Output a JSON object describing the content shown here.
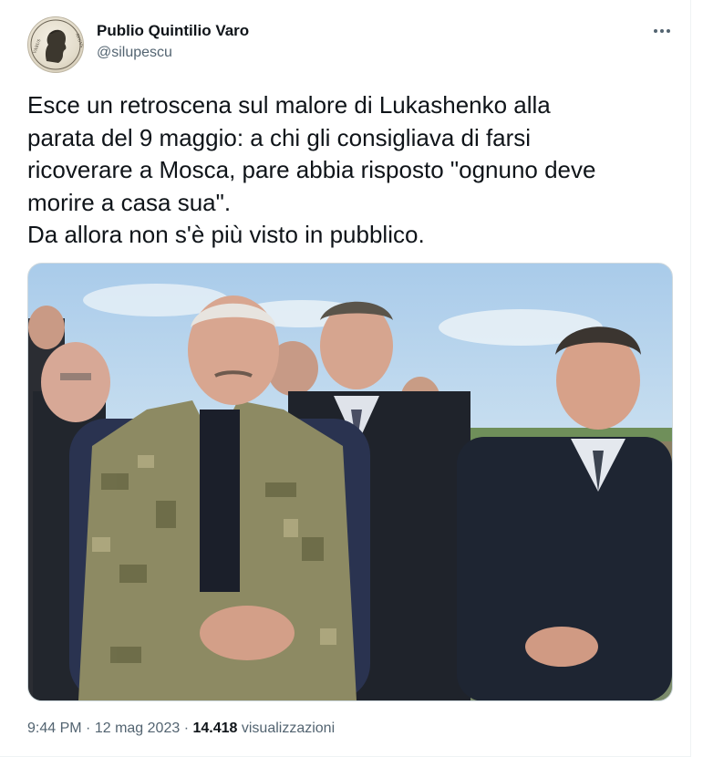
{
  "author": {
    "display_name": "Publio Quintilio Varo",
    "handle": "@silupescu",
    "avatar_icon": "roman-coin-portrait-icon"
  },
  "tweet": {
    "text": "Esce un retroscena sul malore di Lukashenko alla\nparata del 9 maggio: a chi gli consigliava di farsi\nricoverare a Mosca, pare abbia risposto \"ognuno deve\nmorire a casa sua\".\nDa allora non s'è più visto in pubblico."
  },
  "meta": {
    "time": "9:44 PM",
    "separator": "·",
    "date": "12 mag 2023",
    "views_count": "14.418",
    "views_label": "visualizzazioni"
  },
  "more_icon": "more-horizontal-icon",
  "colors": {
    "text_primary": "#0f1419",
    "text_secondary": "#536471",
    "border": "#cfd9de"
  }
}
